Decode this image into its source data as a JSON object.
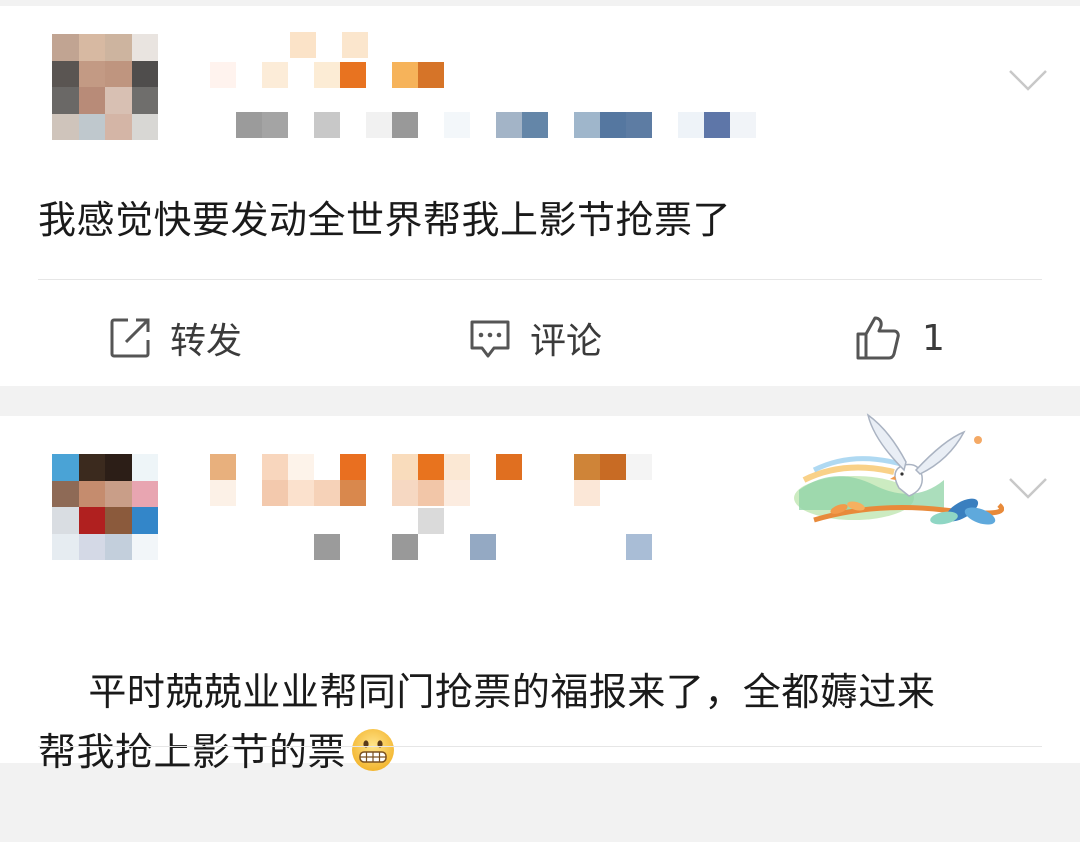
{
  "posts": [
    {
      "text": "我感觉快要发动全世界帮我上影节抢票了",
      "actions": {
        "repost_label": "转发",
        "comment_label": "评论",
        "like_count": "1"
      }
    },
    {
      "text": "平时兢兢业业帮同门抢票的福报来了，全都薅过来\n帮我抢上影节的票",
      "emoji_icon": "grimacing-face-icon"
    }
  ],
  "icons": {
    "menu": "chevron-down-icon",
    "repost": "repost-icon",
    "comment": "comment-icon",
    "like": "thumbs-up-icon",
    "badge": "dove-badge-icon"
  },
  "colors": {
    "text": "#1a1a1a",
    "divider": "#e6e6e6",
    "icon": "#555555",
    "background": "#f2f2f2"
  }
}
